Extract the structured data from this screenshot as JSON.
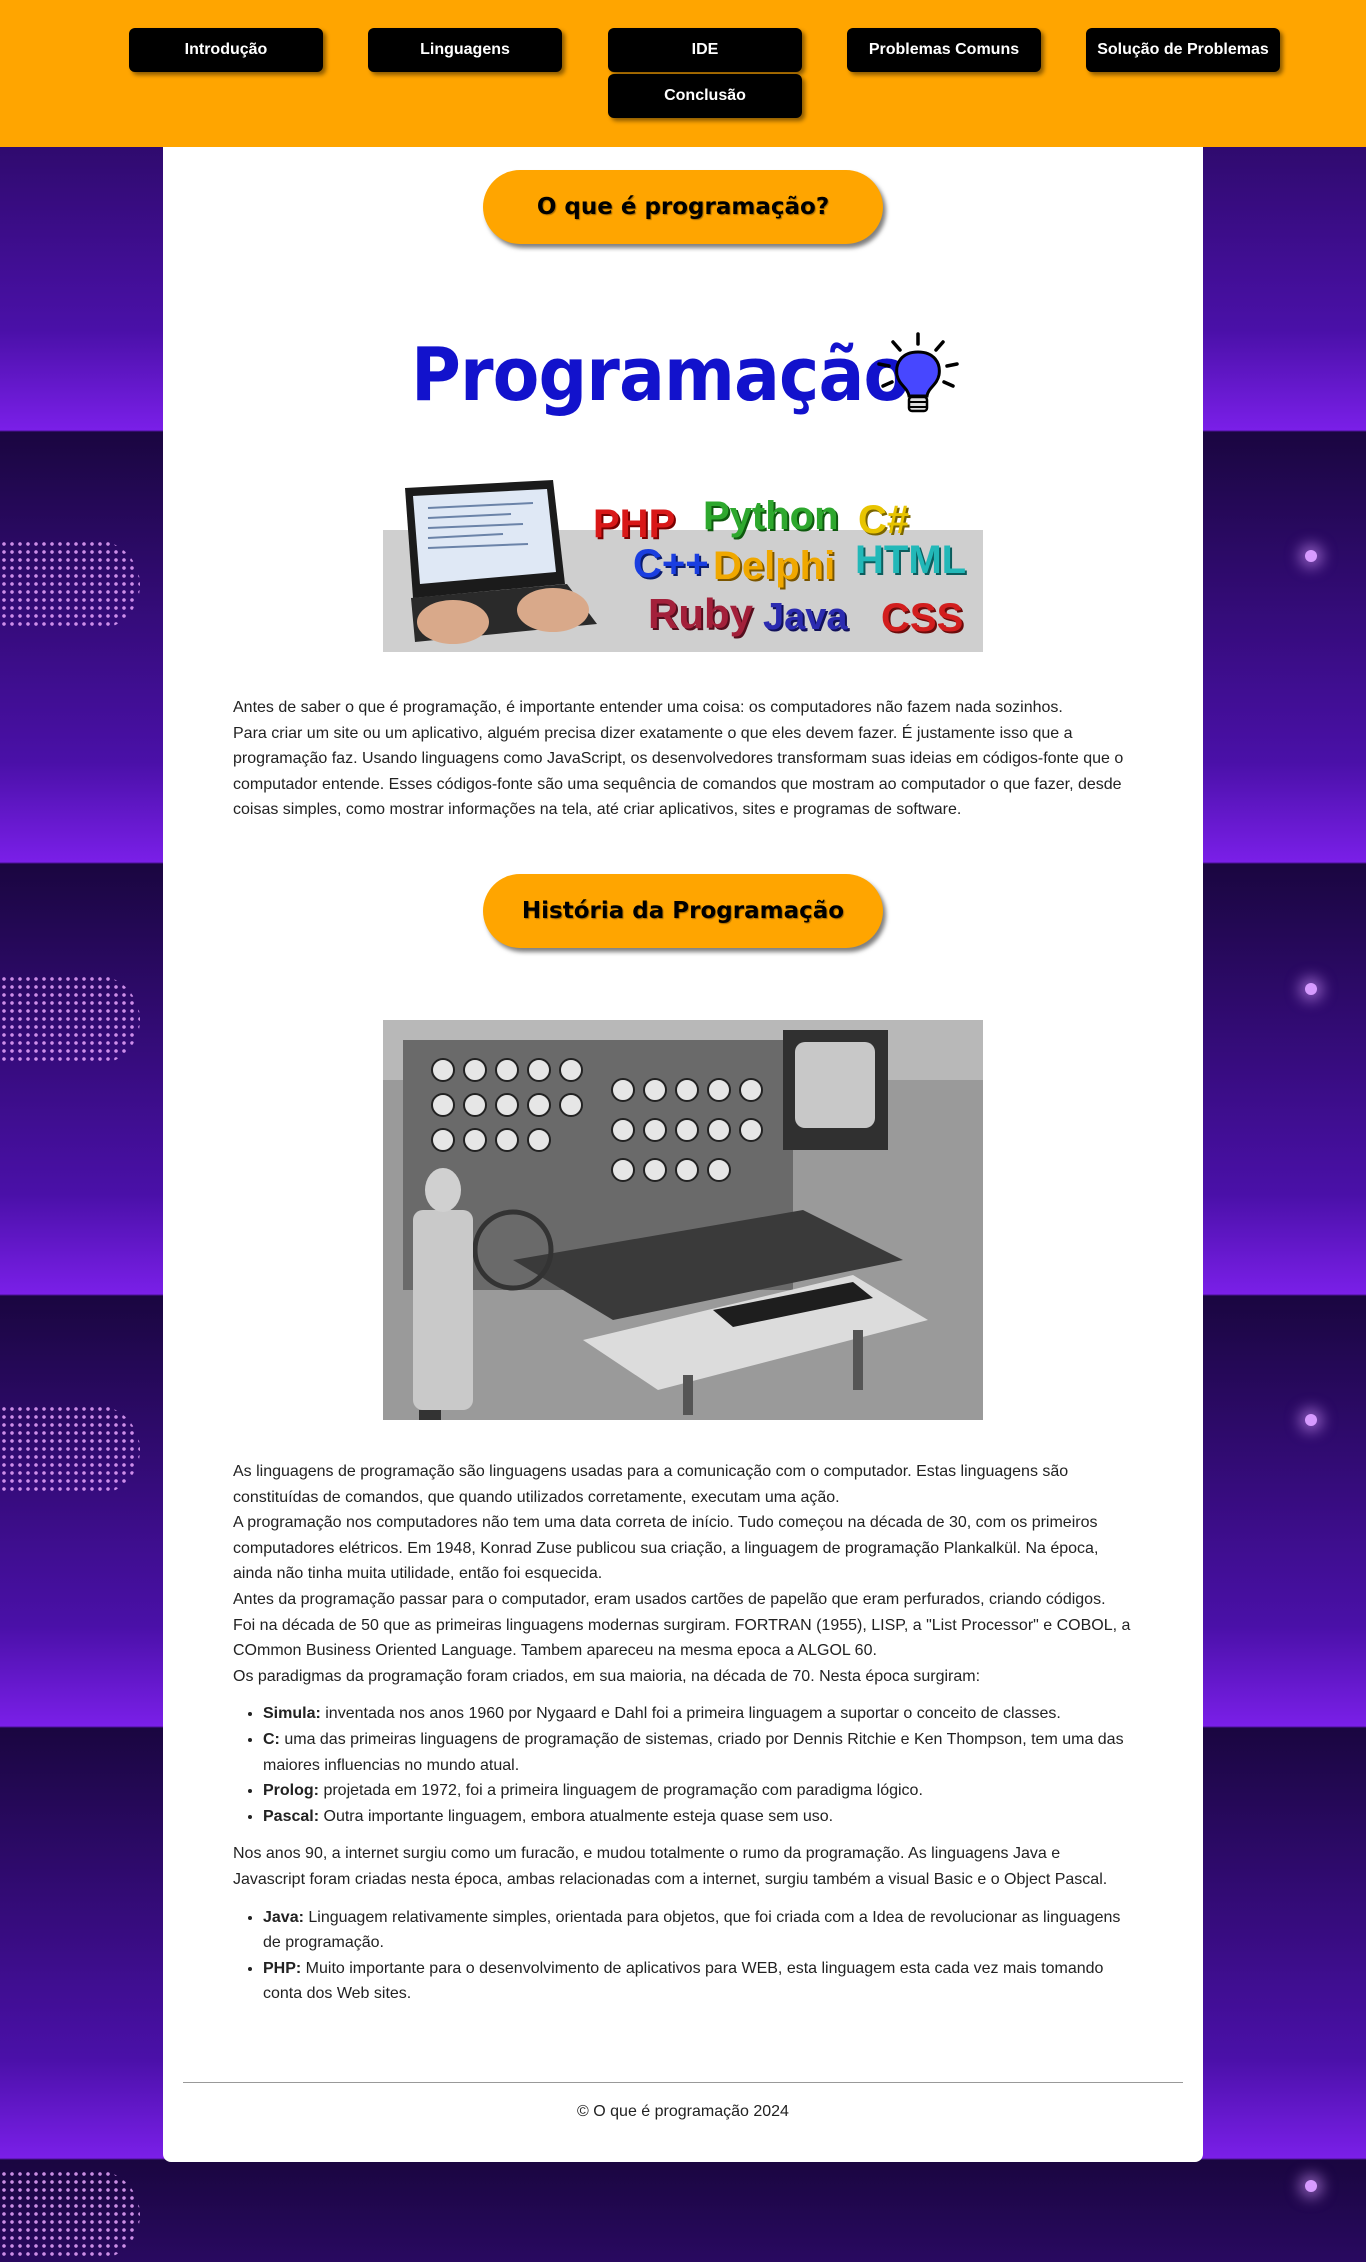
{
  "nav": {
    "items": [
      {
        "label": "Introdução"
      },
      {
        "label": "Linguagens"
      },
      {
        "label": "IDE"
      },
      {
        "label": "Problemas Comuns"
      },
      {
        "label": "Solução de Problemas"
      },
      {
        "label": "Conclusão"
      }
    ]
  },
  "section1": {
    "heading": "O que é programação?",
    "logo_word": "Programação",
    "banner_words": [
      "PHP",
      "Python",
      "C#",
      "C++",
      "Delphi",
      "HTML",
      "Ruby",
      "Java",
      "CSS"
    ],
    "paragraph_lines": [
      "Antes de saber o que é programação, é importante entender uma coisa: os computadores não fazem nada sozinhos.",
      "Para criar um site ou um aplicativo, alguém precisa dizer exatamente o que eles devem fazer. É justamente isso que a programação faz. Usando linguagens como JavaScript, os desenvolvedores transformam suas ideias em códigos-fonte que o computador entende. Esses códigos-fonte são uma sequência de comandos que mostram ao computador o que fazer, desde coisas simples, como mostrar informações na tela, até criar aplicativos, sites e programas de software."
    ]
  },
  "section2": {
    "heading": "História da Programação",
    "paragraphs": [
      "As linguagens de programação são linguagens usadas para a comunicação com o computador. Estas linguagens são constituídas de comandos, que quando utilizados corretamente, executam uma ação.",
      "A programação nos computadores não tem uma data correta de início. Tudo começou na década de 30, com os primeiros computadores elétricos. Em 1948, Konrad Zuse publicou sua criação, a linguagem de programação Plankalkül. Na época, ainda não tinha muita utilidade, então foi esquecida.",
      "Antes da programação passar para o computador, eram usados cartões de papelão que eram perfurados, criando códigos.",
      "Foi na década de 50 que as primeiras linguagens modernas surgiram. FORTRAN (1955), LISP, a \"List Processor\" e COBOL, a COmmon Business Oriented Language. Tambem apareceu na mesma epoca a ALGOL 60.",
      "Os paradigmas da programação foram criados, em sua maioria, na década de 70. Nesta época surgiram:"
    ],
    "list1": [
      {
        "name": "Simula:",
        "text": " inventada nos anos 1960 por Nygaard e Dahl foi a primeira linguagem a suportar o conceito de classes."
      },
      {
        "name": "C:",
        "text": " uma das primeiras linguagens de programação de sistemas, criado por Dennis Ritchie e Ken Thompson, tem uma das maiores influencias no mundo atual."
      },
      {
        "name": "Prolog:",
        "text": " projetada em 1972, foi a primeira linguagem de programação com paradigma lógico."
      },
      {
        "name": "Pascal:",
        "text": " Outra importante linguagem, embora atualmente esteja quase sem uso."
      }
    ],
    "paragraph_90s": "Nos anos 90, a internet surgiu como um furacão, e mudou totalmente o rumo da programação. As linguagens Java e Javascript foram criadas nesta época, ambas relacionadas com a internet, surgiu também a visual Basic e o Object Pascal.",
    "list2": [
      {
        "name": "Java:",
        "text": " Linguagem relativamente simples, orientada para objetos, que foi criada com a Idea de revolucionar as linguagens de programação."
      },
      {
        "name": "PHP:",
        "text": " Muito importante para o desenvolvimento de aplicativos para WEB, esta linguagem esta cada vez mais tomando conta dos Web sites."
      }
    ]
  },
  "footer": {
    "text": "© O que é programação 2024"
  },
  "colors": {
    "accent": "#ffa500",
    "logo_blue": "#1212cc",
    "nav_bg": "#000000"
  }
}
